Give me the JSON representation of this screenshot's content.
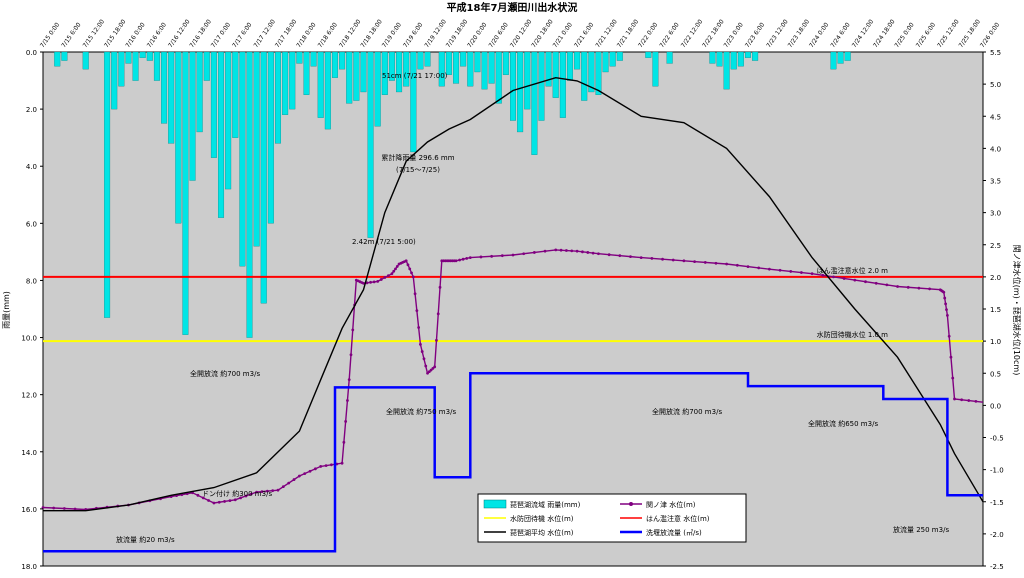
{
  "chart_data": {
    "type": "line",
    "title": "平成18年7月瀬田川出水状況",
    "ylabel_left": "雨量(mm)",
    "ylabel_right": "関ノ津水位(m)・琵琶湖水位(10cm)",
    "ylim_left": [
      0,
      18
    ],
    "ylim_right": [
      -2.5,
      5.5
    ],
    "left_ticks": [
      "0.0",
      "2.0",
      "4.0",
      "6.0",
      "8.0",
      "10.0",
      "12.0",
      "14.0",
      "16.0",
      "18.0"
    ],
    "right_ticks": [
      "5.5",
      "5.0",
      "4.5",
      "4.0",
      "3.5",
      "3.0",
      "2.5",
      "2.0",
      "1.5",
      "1.0",
      "0.5",
      "0.0",
      "-0.5",
      "-1.0",
      "-1.5",
      "-2.0",
      "-2.5"
    ],
    "x_range_hours": [
      0,
      264
    ],
    "x_tick_labels": [
      "7/15 0:00",
      "7/15 6:00",
      "7/15 12:00",
      "7/15 18:00",
      "7/16 0:00",
      "7/16 6:00",
      "7/16 12:00",
      "7/16 18:00",
      "7/17 0:00",
      "7/17 6:00",
      "7/17 12:00",
      "7/17 18:00",
      "7/18 0:00",
      "7/18 6:00",
      "7/18 12:00",
      "7/18 18:00",
      "7/19 0:00",
      "7/19 6:00",
      "7/19 12:00",
      "7/19 18:00",
      "7/20 0:00",
      "7/20 6:00",
      "7/20 12:00",
      "7/20 18:00",
      "7/21 0:00",
      "7/21 6:00",
      "7/21 12:00",
      "7/21 18:00",
      "7/22 0:00",
      "7/22 6:00",
      "7/22 12:00",
      "7/22 18:00",
      "7/23 0:00",
      "7/23 6:00",
      "7/23 12:00",
      "7/23 18:00",
      "7/24 0:00",
      "7/24 6:00",
      "7/24 12:00",
      "7/24 18:00",
      "7/25 0:00",
      "7/25 6:00",
      "7/25 12:00",
      "7/25 18:00",
      "7/26 0:00"
    ],
    "colors": {
      "rain": "#00e5e5",
      "sekinotsu": "#800080",
      "lake": "#000000",
      "discharge": "#0000ff",
      "warn_flood": "#ff0000",
      "warn_standby": "#ffff00",
      "plot_bg": "#cccccc"
    },
    "thresholds": [
      {
        "name": "はん濫注意水位 2.0 m",
        "value": 2.0,
        "key": "warn_flood"
      },
      {
        "name": "水防団待機水位 1.0 m",
        "value": 1.0,
        "key": "warn_standby"
      }
    ],
    "series": [
      {
        "name": "琵琶湖流域 雨量(mm)",
        "axis": "left",
        "style": "bar",
        "key": "rain",
        "x": [
          4,
          6,
          12,
          18,
          20,
          22,
          24,
          26,
          28,
          30,
          32,
          34,
          36,
          38,
          40,
          42,
          44,
          46,
          48,
          50,
          52,
          54,
          56,
          58,
          60,
          62,
          64,
          66,
          68,
          70,
          72,
          74,
          76,
          78,
          80,
          82,
          84,
          86,
          88,
          90,
          92,
          94,
          96,
          98,
          100,
          102,
          104,
          106,
          108,
          112,
          114,
          116,
          118,
          120,
          122,
          124,
          126,
          128,
          130,
          132,
          134,
          136,
          138,
          140,
          142,
          144,
          146,
          148,
          150,
          152,
          154,
          156,
          158,
          160,
          162,
          170,
          172,
          176,
          188,
          190,
          192,
          194,
          196,
          198,
          200,
          222,
          224,
          226
        ],
        "values": [
          0.5,
          0.3,
          0.6,
          9.3,
          2.0,
          1.2,
          0.4,
          1.0,
          0.2,
          0.3,
          1.0,
          2.5,
          3.2,
          6.0,
          9.9,
          4.5,
          2.8,
          1.0,
          3.7,
          5.8,
          4.8,
          3.0,
          7.5,
          10.0,
          6.8,
          8.8,
          6.0,
          3.2,
          2.2,
          2.0,
          0.4,
          1.5,
          0.5,
          2.3,
          2.7,
          0.9,
          0.6,
          1.8,
          1.7,
          1.4,
          6.5,
          2.6,
          1.5,
          1.0,
          1.4,
          1.2,
          3.5,
          0.6,
          0.5,
          1.2,
          0.8,
          1.1,
          0.5,
          1.2,
          0.7,
          1.3,
          1.1,
          1.8,
          0.8,
          2.4,
          2.8,
          2.0,
          3.6,
          2.4,
          1.2,
          1.6,
          2.3,
          1.0,
          0.6,
          1.7,
          1.4,
          1.5,
          0.7,
          0.5,
          0.3,
          0.2,
          1.2,
          0.4,
          0.4,
          0.5,
          1.3,
          0.6,
          0.5,
          0.2,
          0.3,
          0.6,
          0.4,
          0.3
        ]
      },
      {
        "name": "関ノ津 水位(m)",
        "axis": "right",
        "style": "line-marker",
        "key": "sekinotsu",
        "x": [
          0,
          12,
          24,
          36,
          42,
          48,
          54,
          60,
          66,
          72,
          78,
          84,
          86,
          88,
          90,
          94,
          98,
          100,
          102,
          104,
          106,
          108,
          110,
          112,
          114,
          116,
          120,
          132,
          144,
          150,
          156,
          168,
          180,
          192,
          204,
          216,
          228,
          240,
          252,
          253,
          254,
          256,
          264
        ],
        "y": [
          -1.59,
          -1.62,
          -1.55,
          -1.42,
          -1.36,
          -1.52,
          -1.47,
          -1.35,
          -1.32,
          -1.1,
          -0.95,
          -0.9,
          0.4,
          1.95,
          1.9,
          1.93,
          2.05,
          2.2,
          2.25,
          2.0,
          0.95,
          0.5,
          0.6,
          2.25,
          2.25,
          2.25,
          2.3,
          2.34,
          2.42,
          2.4,
          2.36,
          2.3,
          2.25,
          2.2,
          2.12,
          2.05,
          1.95,
          1.85,
          1.8,
          1.76,
          1.4,
          0.1,
          0.05
        ]
      },
      {
        "name": "琵琶湖平均 水位(m)",
        "axis": "right",
        "style": "line",
        "key": "lake",
        "x": [
          0,
          12,
          24,
          36,
          48,
          60,
          72,
          78,
          84,
          90,
          96,
          102,
          108,
          114,
          120,
          132,
          144,
          150,
          156,
          168,
          180,
          192,
          204,
          216,
          228,
          240,
          252,
          256,
          264
        ],
        "y": [
          -1.64,
          -1.64,
          -1.55,
          -1.4,
          -1.28,
          -1.05,
          -0.4,
          0.4,
          1.2,
          1.8,
          3.0,
          3.8,
          4.1,
          4.3,
          4.45,
          4.9,
          5.1,
          5.05,
          4.9,
          4.5,
          4.4,
          4.0,
          3.25,
          2.3,
          1.5,
          0.75,
          -0.3,
          -0.75,
          -1.5
        ]
      },
      {
        "name": "洗堰放流量 (㎥/s)",
        "axis": "right",
        "style": "step",
        "key": "discharge",
        "x": [
          0,
          48,
          66,
          80,
          82,
          90,
          93,
          96,
          108,
          110,
          114,
          120,
          160,
          198,
          226,
          236,
          244,
          254,
          264
        ],
        "y": [
          -2.27,
          -2.27,
          -2.27,
          -2.27,
          0.28,
          0.28,
          0.28,
          0.28,
          0.28,
          -1.12,
          -1.12,
          0.5,
          0.5,
          0.3,
          0.3,
          0.1,
          0.1,
          -1.4,
          -1.4
        ]
      }
    ],
    "annotations": {
      "lake_peak": "51cm  (7/21 17:00)",
      "cum_rain_1": "累計降雨量 296.6 mm",
      "cum_rain_2": "(7/15〜7/25)",
      "sek_peak": "2.42m  (7/21 5:00)",
      "full700a": "全開放流 約700 m3/s",
      "full750": "全開放流 約750 m3/s",
      "full700b": "全開放流 約700 m3/s",
      "full650": "全開放流 約650 m3/s",
      "down300": "ドン付け 約300 m3/s",
      "q20": "放流量 約20 m3/s",
      "q250": "放流量 250 m3/s"
    },
    "legend": {
      "position": "bottom-center",
      "items": [
        {
          "label": "琵琶湖流域 雨量(mm)",
          "key": "rain",
          "kind": "bar"
        },
        {
          "label": "関ノ津 水位(m)",
          "key": "sekinotsu",
          "kind": "line-marker"
        },
        {
          "label": "水防団待機 水位(m)",
          "key": "warn_standby",
          "kind": "line"
        },
        {
          "label": "はん濫注意 水位(m)",
          "key": "warn_flood",
          "kind": "line"
        },
        {
          "label": "琵琶湖平均 水位(m)",
          "key": "lake",
          "kind": "line"
        },
        {
          "label": "洗堰放流量 (㎥/s)",
          "key": "discharge",
          "kind": "line"
        }
      ]
    }
  }
}
